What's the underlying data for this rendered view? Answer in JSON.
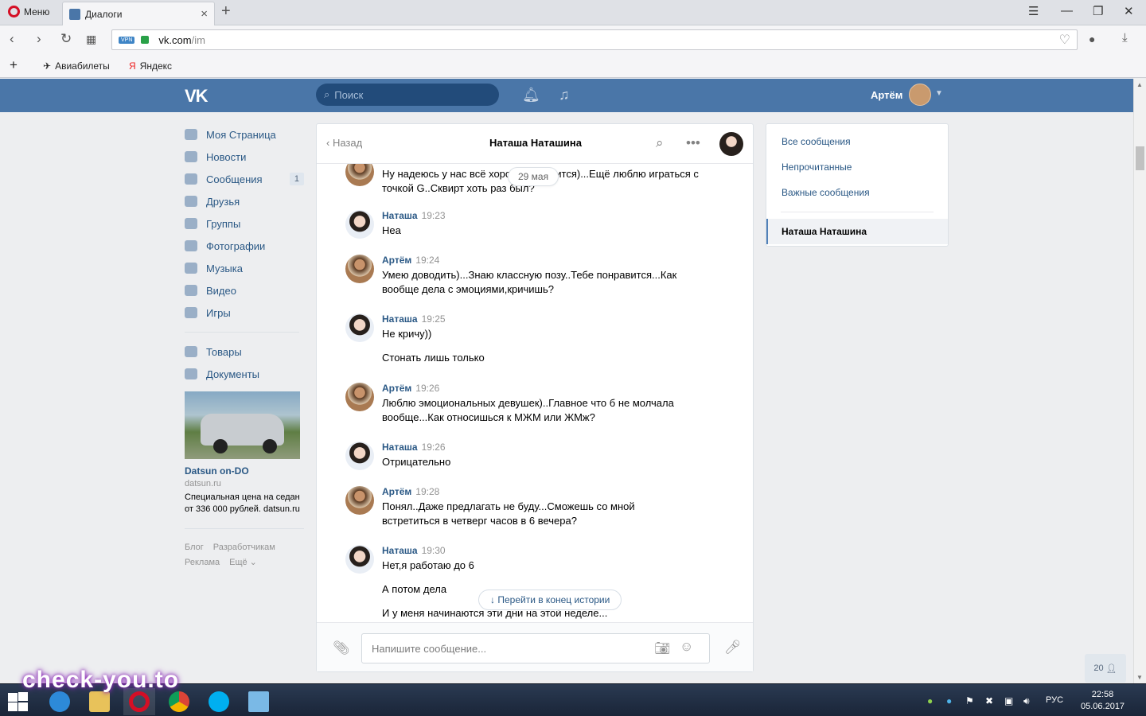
{
  "browser": {
    "menu_label": "Меню",
    "tab_title": "Диалоги",
    "url_host": "vk.com",
    "url_path": "/im",
    "vpn_badge": "VPN",
    "bookmarks": [
      {
        "label": "Авиабилеты"
      },
      {
        "label": "Яндекс"
      }
    ]
  },
  "vk_header": {
    "logo": "VK",
    "search_placeholder": "Поиск",
    "user_name": "Артём"
  },
  "sidebar": {
    "items": [
      {
        "label": "Моя Страница"
      },
      {
        "label": "Новости"
      },
      {
        "label": "Сообщения",
        "badge": "1"
      },
      {
        "label": "Друзья"
      },
      {
        "label": "Группы"
      },
      {
        "label": "Фотографии"
      },
      {
        "label": "Музыка"
      },
      {
        "label": "Видео"
      },
      {
        "label": "Игры"
      }
    ],
    "items2": [
      {
        "label": "Товары"
      },
      {
        "label": "Документы"
      }
    ],
    "ad": {
      "title": "Datsun on-DO",
      "domain": "datsun.ru",
      "text": "Специальная цена на седан от 336 000 рублей. datsun.ru"
    },
    "footer": {
      "blog": "Блог",
      "devs": "Разработчикам",
      "ads": "Реклама",
      "more": "Ещё ⌄"
    }
  },
  "chat": {
    "back_label": "Назад",
    "title": "Наташа Наташина",
    "date_pill": "29 мая",
    "goto_end": "Перейти в конец истории",
    "input_placeholder": "Напишите сообщение...",
    "messages": [
      {
        "author": "",
        "time": "",
        "text": "Ну надеюсь у нас всё хорошо получится)...Ещё люблю играться с точкой G..Сквирт хоть раз был?"
      },
      {
        "author": "Наташа",
        "time": "19:23",
        "text": "Неа"
      },
      {
        "author": "Артём",
        "time": "19:24",
        "text": "Умею доводить)...Знаю классную позу..Тебе понравится...Как вообще дела с эмоциями,кричишь?"
      },
      {
        "author": "Наташа",
        "time": "19:25",
        "text": "Не кричу))",
        "extra": [
          "Стонать лишь только"
        ]
      },
      {
        "author": "Артём",
        "time": "19:26",
        "text": "Люблю эмоциональных девушек)..Главное что б не молчала вообще...Как относишься к МЖМ или ЖМж?"
      },
      {
        "author": "Наташа",
        "time": "19:26",
        "text": "Отрицательно"
      },
      {
        "author": "Артём",
        "time": "19:28",
        "text": "Понял..Даже предлагать не буду...Сможешь со мной встретиться в четверг часов в 6 вечера?"
      },
      {
        "author": "Наташа",
        "time": "19:30",
        "text": "Нет,я работаю до 6",
        "extra": [
          "А потом дела",
          "И у меня начинаются эти дни на этой неделе..."
        ]
      }
    ]
  },
  "right_panel": {
    "items": [
      {
        "label": "Все сообщения"
      },
      {
        "label": "Непрочитанные"
      },
      {
        "label": "Важные сообщения"
      }
    ],
    "active": "Наташа Наташина"
  },
  "online_count": "20",
  "taskbar": {
    "lang": "РУС",
    "time": "22:58",
    "date": "05.06.2017"
  },
  "watermark": "check-you.to"
}
